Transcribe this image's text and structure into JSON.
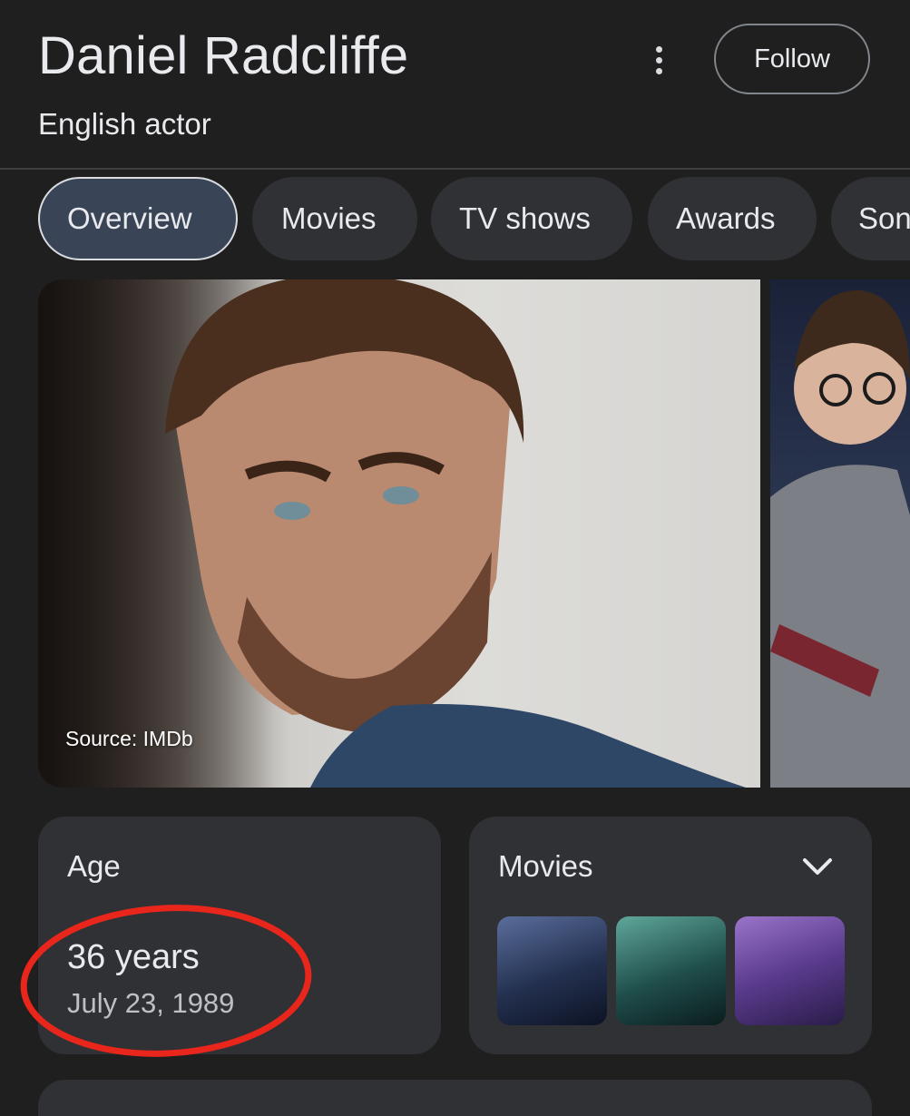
{
  "header": {
    "title": "Daniel Radcliffe",
    "subtitle": "English actor",
    "follow_label": "Follow"
  },
  "tabs": [
    {
      "label": "Overview",
      "active": true
    },
    {
      "label": "Movies",
      "active": false
    },
    {
      "label": "TV shows",
      "active": false
    },
    {
      "label": "Awards",
      "active": false
    },
    {
      "label": "Songs",
      "active": false
    }
  ],
  "hero": {
    "source_label": "Source: IMDb"
  },
  "age_card": {
    "label": "Age",
    "value": "36 years",
    "birth_date": "July 23, 1989"
  },
  "movies_card": {
    "label": "Movies",
    "posters": [
      {
        "name": "Harry Potter poster 1"
      },
      {
        "name": "Harry Potter poster 2"
      },
      {
        "name": "Harry Potter poster 3"
      }
    ]
  },
  "colors": {
    "background": "#1f1f1f",
    "card": "#303134",
    "active_tab": "#394457",
    "annotation": "#e8261b"
  }
}
